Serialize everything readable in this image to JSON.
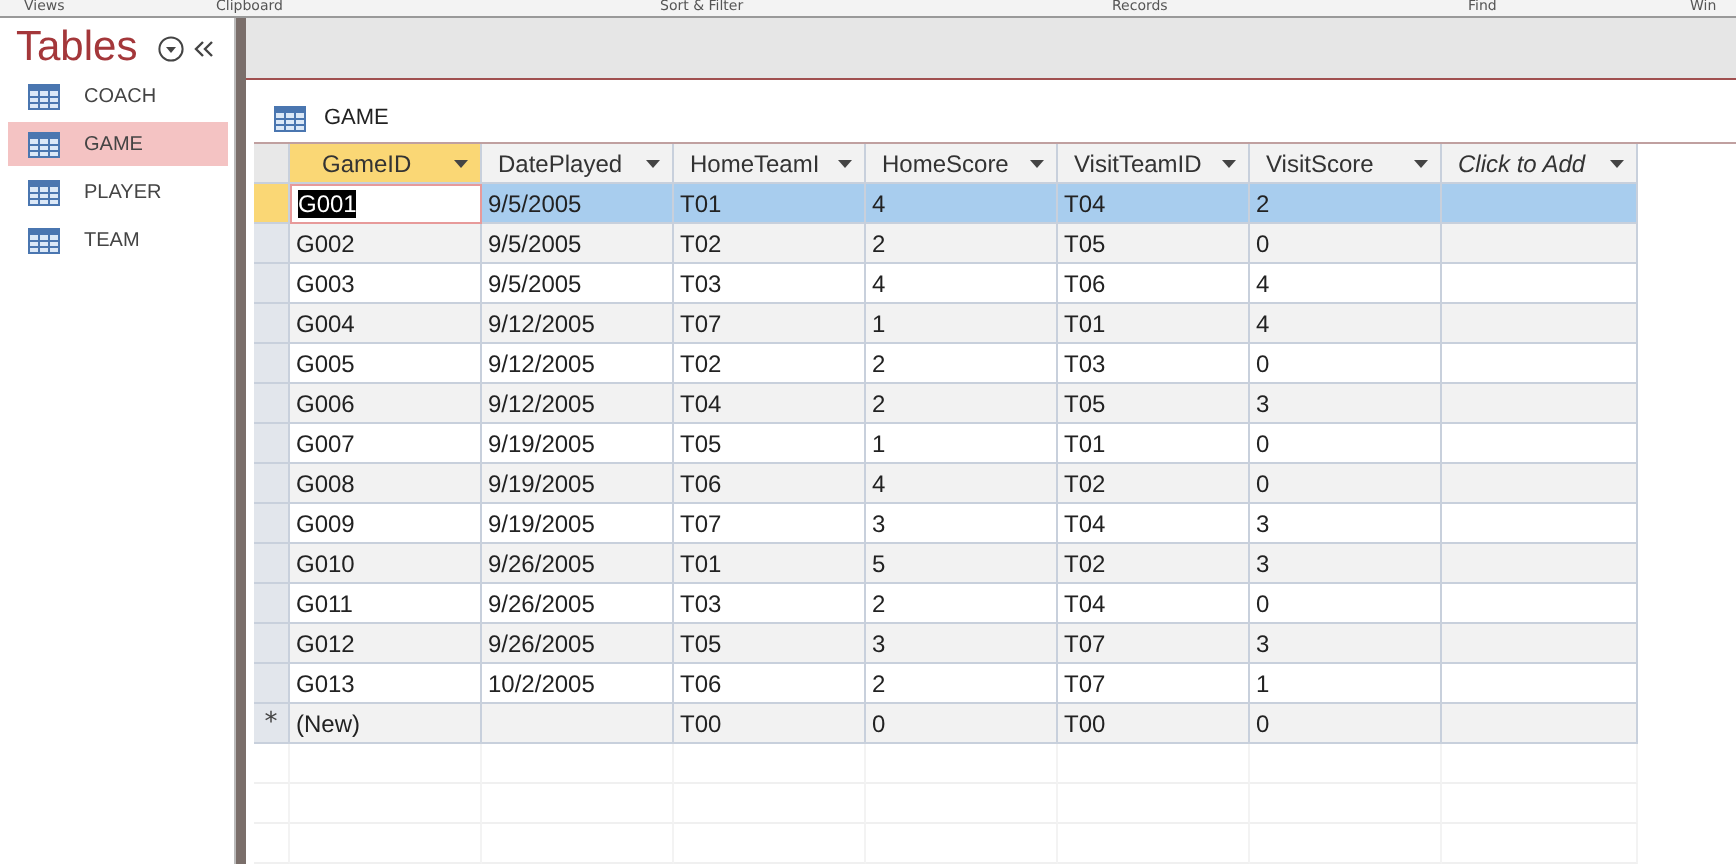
{
  "ribbon_groups": [
    "Views",
    "Clipboard",
    "Sort & Filter",
    "Records",
    "Find",
    "Win"
  ],
  "nav": {
    "title": "Tables",
    "items": [
      {
        "label": "COACH",
        "selected": false
      },
      {
        "label": "GAME",
        "selected": true
      },
      {
        "label": "PLAYER",
        "selected": false
      },
      {
        "label": "TEAM",
        "selected": false
      }
    ]
  },
  "document": {
    "tab_title": "GAME"
  },
  "table": {
    "columns": [
      {
        "label": "GameID",
        "kind": "field",
        "selected": true
      },
      {
        "label": "DatePlayed",
        "kind": "field",
        "selected": false
      },
      {
        "label": "HomeTeamI",
        "kind": "field",
        "selected": false
      },
      {
        "label": "HomeScore",
        "kind": "field",
        "selected": false
      },
      {
        "label": "VisitTeamID",
        "kind": "field",
        "selected": false
      },
      {
        "label": "VisitScore",
        "kind": "field",
        "selected": false
      },
      {
        "label": "Click to Add",
        "kind": "add",
        "selected": false
      }
    ],
    "rows": [
      {
        "kind": "record",
        "selected": true,
        "cells": [
          "G001",
          "9/5/2005",
          "T01",
          "4",
          "T04",
          "2"
        ]
      },
      {
        "kind": "record",
        "selected": false,
        "cells": [
          "G002",
          "9/5/2005",
          "T02",
          "2",
          "T05",
          "0"
        ]
      },
      {
        "kind": "record",
        "selected": false,
        "cells": [
          "G003",
          "9/5/2005",
          "T03",
          "4",
          "T06",
          "4"
        ]
      },
      {
        "kind": "record",
        "selected": false,
        "cells": [
          "G004",
          "9/12/2005",
          "T07",
          "1",
          "T01",
          "4"
        ]
      },
      {
        "kind": "record",
        "selected": false,
        "cells": [
          "G005",
          "9/12/2005",
          "T02",
          "2",
          "T03",
          "0"
        ]
      },
      {
        "kind": "record",
        "selected": false,
        "cells": [
          "G006",
          "9/12/2005",
          "T04",
          "2",
          "T05",
          "3"
        ]
      },
      {
        "kind": "record",
        "selected": false,
        "cells": [
          "G007",
          "9/19/2005",
          "T05",
          "1",
          "T01",
          "0"
        ]
      },
      {
        "kind": "record",
        "selected": false,
        "cells": [
          "G008",
          "9/19/2005",
          "T06",
          "4",
          "T02",
          "0"
        ]
      },
      {
        "kind": "record",
        "selected": false,
        "cells": [
          "G009",
          "9/19/2005",
          "T07",
          "3",
          "T04",
          "3"
        ]
      },
      {
        "kind": "record",
        "selected": false,
        "cells": [
          "G010",
          "9/26/2005",
          "T01",
          "5",
          "T02",
          "3"
        ]
      },
      {
        "kind": "record",
        "selected": false,
        "cells": [
          "G011",
          "9/26/2005",
          "T03",
          "2",
          "T04",
          "0"
        ]
      },
      {
        "kind": "record",
        "selected": false,
        "cells": [
          "G012",
          "9/26/2005",
          "T05",
          "3",
          "T07",
          "3"
        ]
      },
      {
        "kind": "record",
        "selected": false,
        "cells": [
          "G013",
          "10/2/2005",
          "T06",
          "2",
          "T07",
          "1"
        ]
      },
      {
        "kind": "new",
        "selected": false,
        "marker": "*",
        "cells": [
          "(New)",
          "",
          "T00",
          "0",
          "T00",
          "0"
        ]
      }
    ]
  }
}
